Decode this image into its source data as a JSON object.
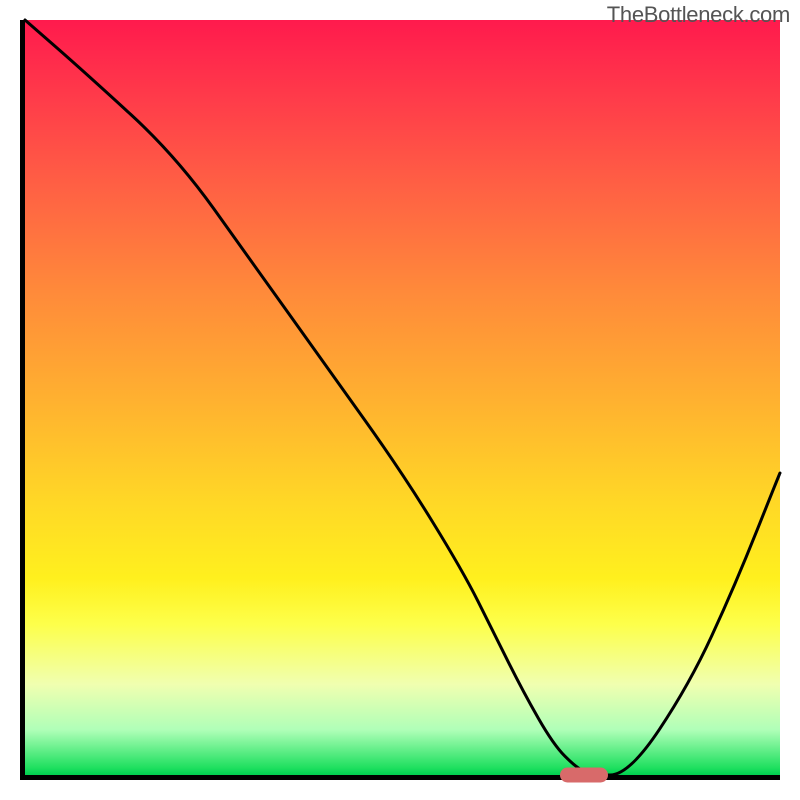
{
  "watermark": "TheBottleneck.com",
  "chart_data": {
    "type": "line",
    "title": "",
    "xlabel": "",
    "ylabel": "",
    "xlim": [
      0,
      100
    ],
    "ylim": [
      0,
      100
    ],
    "grid": false,
    "series": [
      {
        "name": "bottleneck-curve",
        "x": [
          0,
          8,
          20,
          30,
          40,
          50,
          58,
          62,
          66,
          70,
          73,
          75,
          80,
          88,
          94,
          100
        ],
        "values": [
          100,
          93,
          82,
          68,
          54,
          40,
          27,
          19,
          11,
          4,
          1,
          0,
          0,
          12,
          25,
          40
        ]
      }
    ],
    "marker": {
      "x": 74,
      "y": 0,
      "color": "#d86a6a"
    },
    "gradient_stops": [
      {
        "pos": 0,
        "color": "#ff1a4d"
      },
      {
        "pos": 50,
        "color": "#ffb030"
      },
      {
        "pos": 80,
        "color": "#fdff4a"
      },
      {
        "pos": 100,
        "color": "#00d050"
      }
    ]
  }
}
